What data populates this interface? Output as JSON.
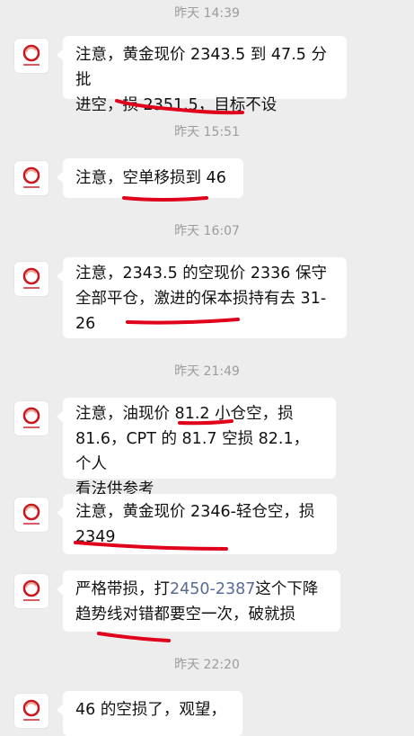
{
  "messages": [
    {
      "time": "昨天 14:39",
      "lines": [
        "注意，黄金现价 2343.5 到 47.5 分批",
        "进空，损 2351.5，目标不设"
      ]
    },
    {
      "time": "昨天 15:51",
      "lines": [
        "注意，空单移损到 46"
      ]
    },
    {
      "time": "昨天 16:07",
      "lines": [
        "注意，2343.5 的空现价 2336 保守",
        "全部平仓，激进的保本损持有去 31-",
        "26"
      ]
    },
    {
      "time": "昨天 21:49",
      "lines": [
        "注意，油现价 81.2 小仓空，损",
        "81.6，CPT 的 81.7 空损 82.1，个人",
        "看法供参考"
      ]
    },
    {
      "lines": [
        "注意，黄金现价 2346-轻仓空，损",
        "2349"
      ]
    },
    {
      "line1_prefix": "严格带损，打",
      "line1_link": "2450-2387",
      "line1_suffix": "这个下降",
      "line2": "趋势线对错都要空一次，破就损"
    },
    {
      "time": "昨天 22:20",
      "lines": [
        "46 的空损了，观望，"
      ]
    }
  ],
  "colors": {
    "background": "#ededed",
    "bubble": "#ffffff",
    "timestamp": "#9c9c9c",
    "link": "#576b95",
    "annotation": "#e0001b",
    "avatar_logo": "#c8171e"
  }
}
